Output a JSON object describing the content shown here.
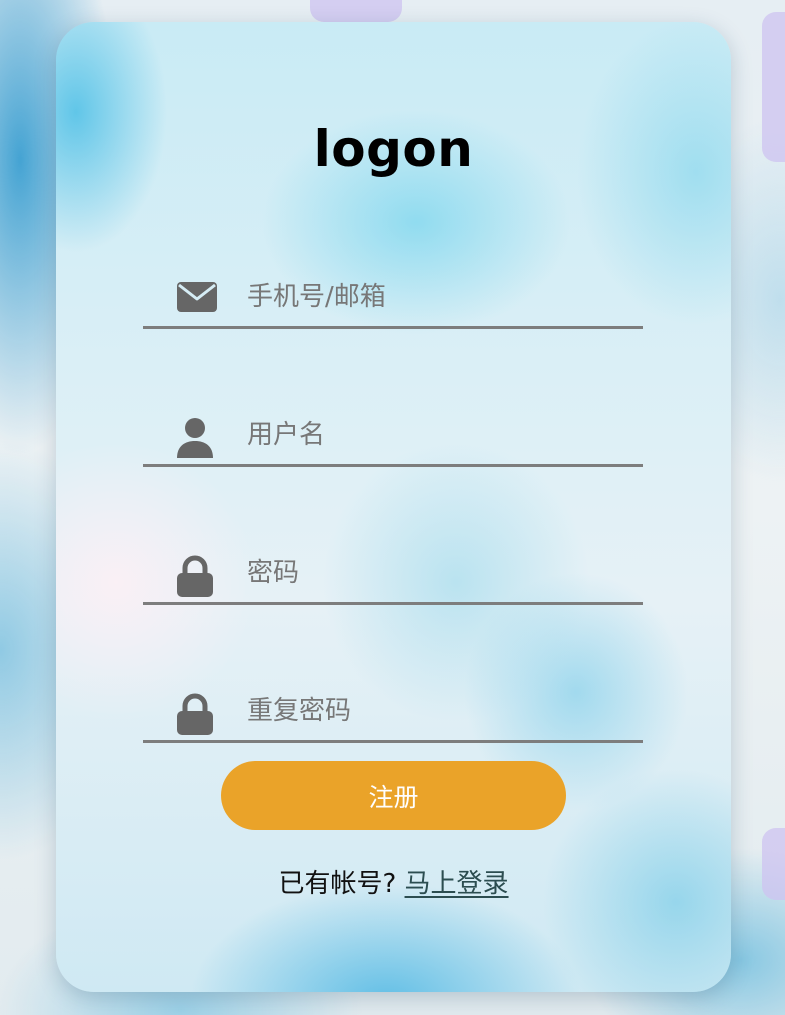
{
  "title": "logon",
  "fields": [
    {
      "icon": "envelope-icon",
      "placeholder": "手机号/邮箱",
      "value": ""
    },
    {
      "icon": "user-icon",
      "placeholder": "用户名",
      "value": ""
    },
    {
      "icon": "lock-icon",
      "placeholder": "密码",
      "value": ""
    },
    {
      "icon": "lock-icon",
      "placeholder": "重复密码",
      "value": ""
    }
  ],
  "register_button": {
    "label": "注册"
  },
  "login_prompt": {
    "text": "已有帐号?",
    "link": "马上登录"
  },
  "colors": {
    "button": "#eaa329",
    "button_text": "#ffffff",
    "icon": "#666666",
    "underline": "#7d7d7d",
    "placeholder": "#777777",
    "deco": "#cdc3f0"
  }
}
